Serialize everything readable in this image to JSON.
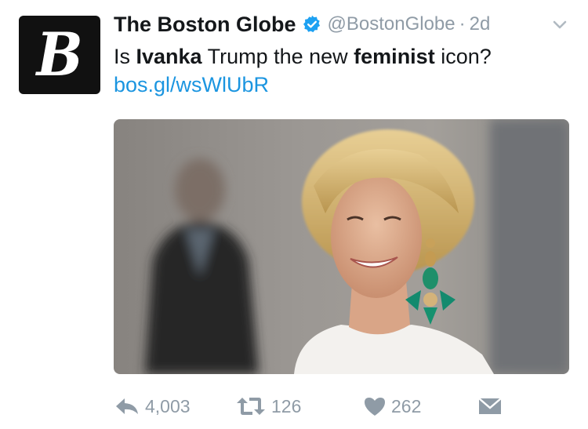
{
  "tweet": {
    "avatar_letter": "B",
    "display_name": "The Boston Globe",
    "handle": "@BostonGlobe",
    "separator": "·",
    "time": "2d",
    "text": {
      "part1": "Is ",
      "bold1": "Ivanka",
      "part2": " Trump the new ",
      "bold2": "feminist",
      "part3": " icon?"
    },
    "link": "bos.gl/wsWlUbR"
  },
  "icons": {
    "verified": "verified-badge-icon",
    "menu": "chevron-down-icon",
    "reply": "reply-icon",
    "retweet": "retweet-icon",
    "like": "heart-icon",
    "dm": "direct-message-icon"
  },
  "actions": {
    "reply_count": "4,003",
    "retweet_count": "126",
    "like_count": "262"
  },
  "colors": {
    "link": "#1b95e0",
    "verified": "#1da1f2",
    "muted": "#8f9ba6",
    "text": "#14171a"
  }
}
